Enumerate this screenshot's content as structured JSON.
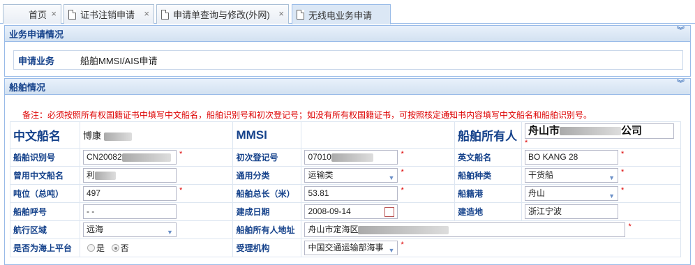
{
  "tabs": [
    {
      "label": "首页",
      "icon": "none",
      "active": false
    },
    {
      "label": "证书注销申请",
      "icon": "document-icon",
      "active": false
    },
    {
      "label": "申请单查询与修改(外网)",
      "icon": "document-icon",
      "active": false
    },
    {
      "label": "无线电业务申请",
      "icon": "document-icon",
      "active": true
    }
  ],
  "tab_close": "×",
  "business_panel": {
    "title": "业务申请情况",
    "apply_label": "申请业务",
    "apply_value": "船舶MMSI/AIS申请"
  },
  "ship_panel": {
    "title": "船舶情况",
    "notice": "备注：必须按照所有权国籍证书中填写中文船名，船舶识别号和初次登记号；如没有所有权国籍证书，可按照核定通知书内容填写中文船名和船舶识别号。",
    "fields": {
      "cn_name_label": "中文船名",
      "cn_name_value": "博康",
      "mmsi_label": "MMSI",
      "owner_label": "船舶所有人",
      "owner_value_prefix": "舟山市",
      "owner_value_suffix": "公司",
      "ship_id_label": "船舶识别号",
      "ship_id_value": "CN20082",
      "first_reg_label": "初次登记号",
      "first_reg_value": "07010",
      "en_name_label": "英文船名",
      "en_name_value": "BO KANG 28",
      "former_name_label": "曾用中文船名",
      "former_name_value": "利",
      "general_class_label": "通用分类",
      "general_class_value": "运输类",
      "ship_type_label": "船舶种类",
      "ship_type_value": "干货船",
      "tonnage_label": "吨位（总吨）",
      "tonnage_value": "497",
      "length_label": "船舶总长（米）",
      "length_value": "53.81",
      "port_label": "船籍港",
      "port_value": "舟山",
      "call_sign_label": "船舶呼号",
      "call_sign_value": "- -",
      "build_date_label": "建成日期",
      "build_date_value": "2008-09-14",
      "build_place_label": "建造地",
      "build_place_value": "浙江宁波",
      "nav_area_label": "航行区域",
      "nav_area_value": "远海",
      "owner_addr_label": "船舶所有人地址",
      "owner_addr_value": "舟山市定海区",
      "platform_label": "是否为海上平台",
      "platform_yes": "是",
      "platform_no": "否",
      "agency_label": "受理机构",
      "agency_value": "中国交通运输部海事"
    },
    "required_mark": "*"
  },
  "colors": {
    "header_text": "#15428b",
    "border": "#99bbe8",
    "required": "#dd0000"
  }
}
